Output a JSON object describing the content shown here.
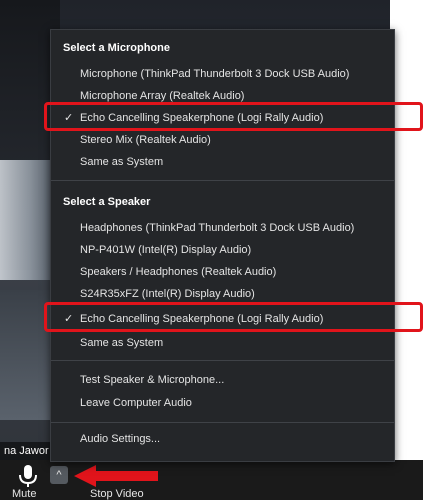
{
  "name_tag": "na Jawor",
  "microphone_section": {
    "title": "Select a Microphone",
    "items": [
      {
        "label": "Microphone (ThinkPad Thunderbolt 3 Dock USB Audio)",
        "checked": false
      },
      {
        "label": "Microphone Array (Realtek Audio)",
        "checked": false
      },
      {
        "label": "Echo Cancelling Speakerphone (Logi Rally Audio)",
        "checked": true
      },
      {
        "label": "Stereo Mix (Realtek Audio)",
        "checked": false
      },
      {
        "label": "Same as System",
        "checked": false
      }
    ]
  },
  "speaker_section": {
    "title": "Select a Speaker",
    "items": [
      {
        "label": "Headphones (ThinkPad Thunderbolt 3 Dock USB Audio)",
        "checked": false
      },
      {
        "label": "NP-P401W (Intel(R) Display Audio)",
        "checked": false
      },
      {
        "label": "Speakers / Headphones (Realtek Audio)",
        "checked": false
      },
      {
        "label": "S24R35xFZ (Intel(R) Display Audio)",
        "checked": false
      },
      {
        "label": "Echo Cancelling Speakerphone (Logi Rally Audio)",
        "checked": true
      },
      {
        "label": "Same as System",
        "checked": false
      }
    ]
  },
  "actions": {
    "test": "Test Speaker & Microphone...",
    "leave": "Leave Computer Audio",
    "settings": "Audio Settings..."
  },
  "toolbar": {
    "mute_label": "Mute",
    "stop_video_label": "Stop Video",
    "caret_glyph": "^"
  },
  "check_glyph": "✓",
  "icons": {
    "mic": "microphone-icon",
    "caret": "chevron-up-icon",
    "arrow": "red-arrow-annotation"
  },
  "colors": {
    "menu_bg": "#242629",
    "highlight": "#e1141b",
    "toolbar_bg": "#1a1a1a"
  }
}
